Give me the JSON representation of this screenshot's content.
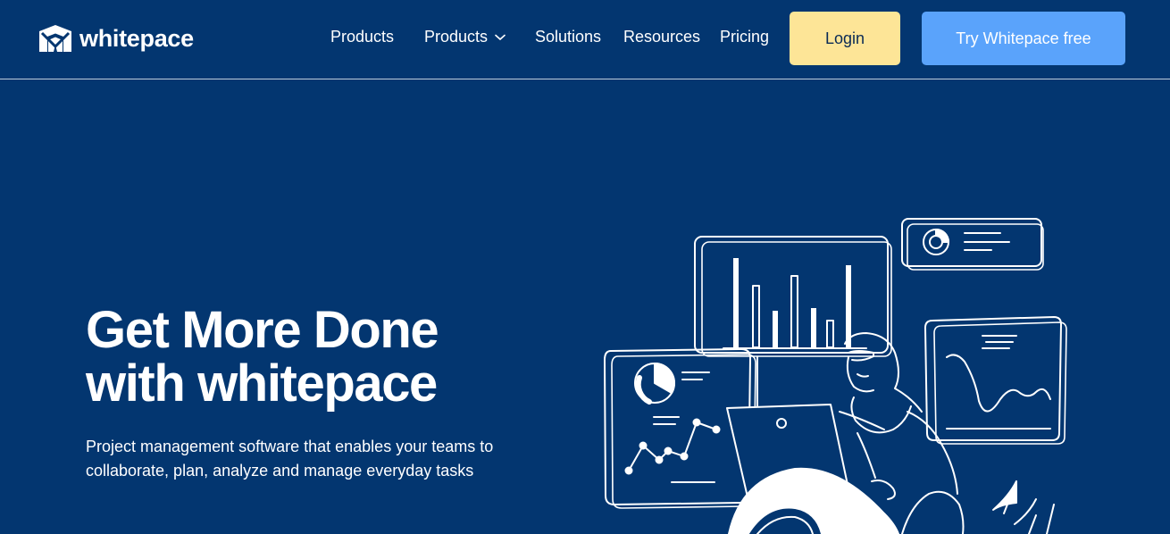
{
  "brand": {
    "name": "whitepace"
  },
  "nav": {
    "items": [
      {
        "label": "Products"
      },
      {
        "label": "Products",
        "dropdown": true
      },
      {
        "label": "Solutions"
      },
      {
        "label": "Resources"
      },
      {
        "label": "Pricing"
      }
    ],
    "login_label": "Login",
    "cta_label": "Try Whitepace free"
  },
  "hero": {
    "title_line1": "Get More Done",
    "title_line2": "with whitepace",
    "subtitle_line1": "Project management software that enables your teams to",
    "subtitle_line2": "collaborate, plan, analyze and manage everyday tasks"
  },
  "colors": {
    "background": "#033670",
    "login_button": "#fde597",
    "cta_button": "#5aa3fb",
    "text": "#ffffff"
  },
  "icons": {
    "logo": "whitepace-logo-icon",
    "dropdown": "chevron-down-icon"
  }
}
